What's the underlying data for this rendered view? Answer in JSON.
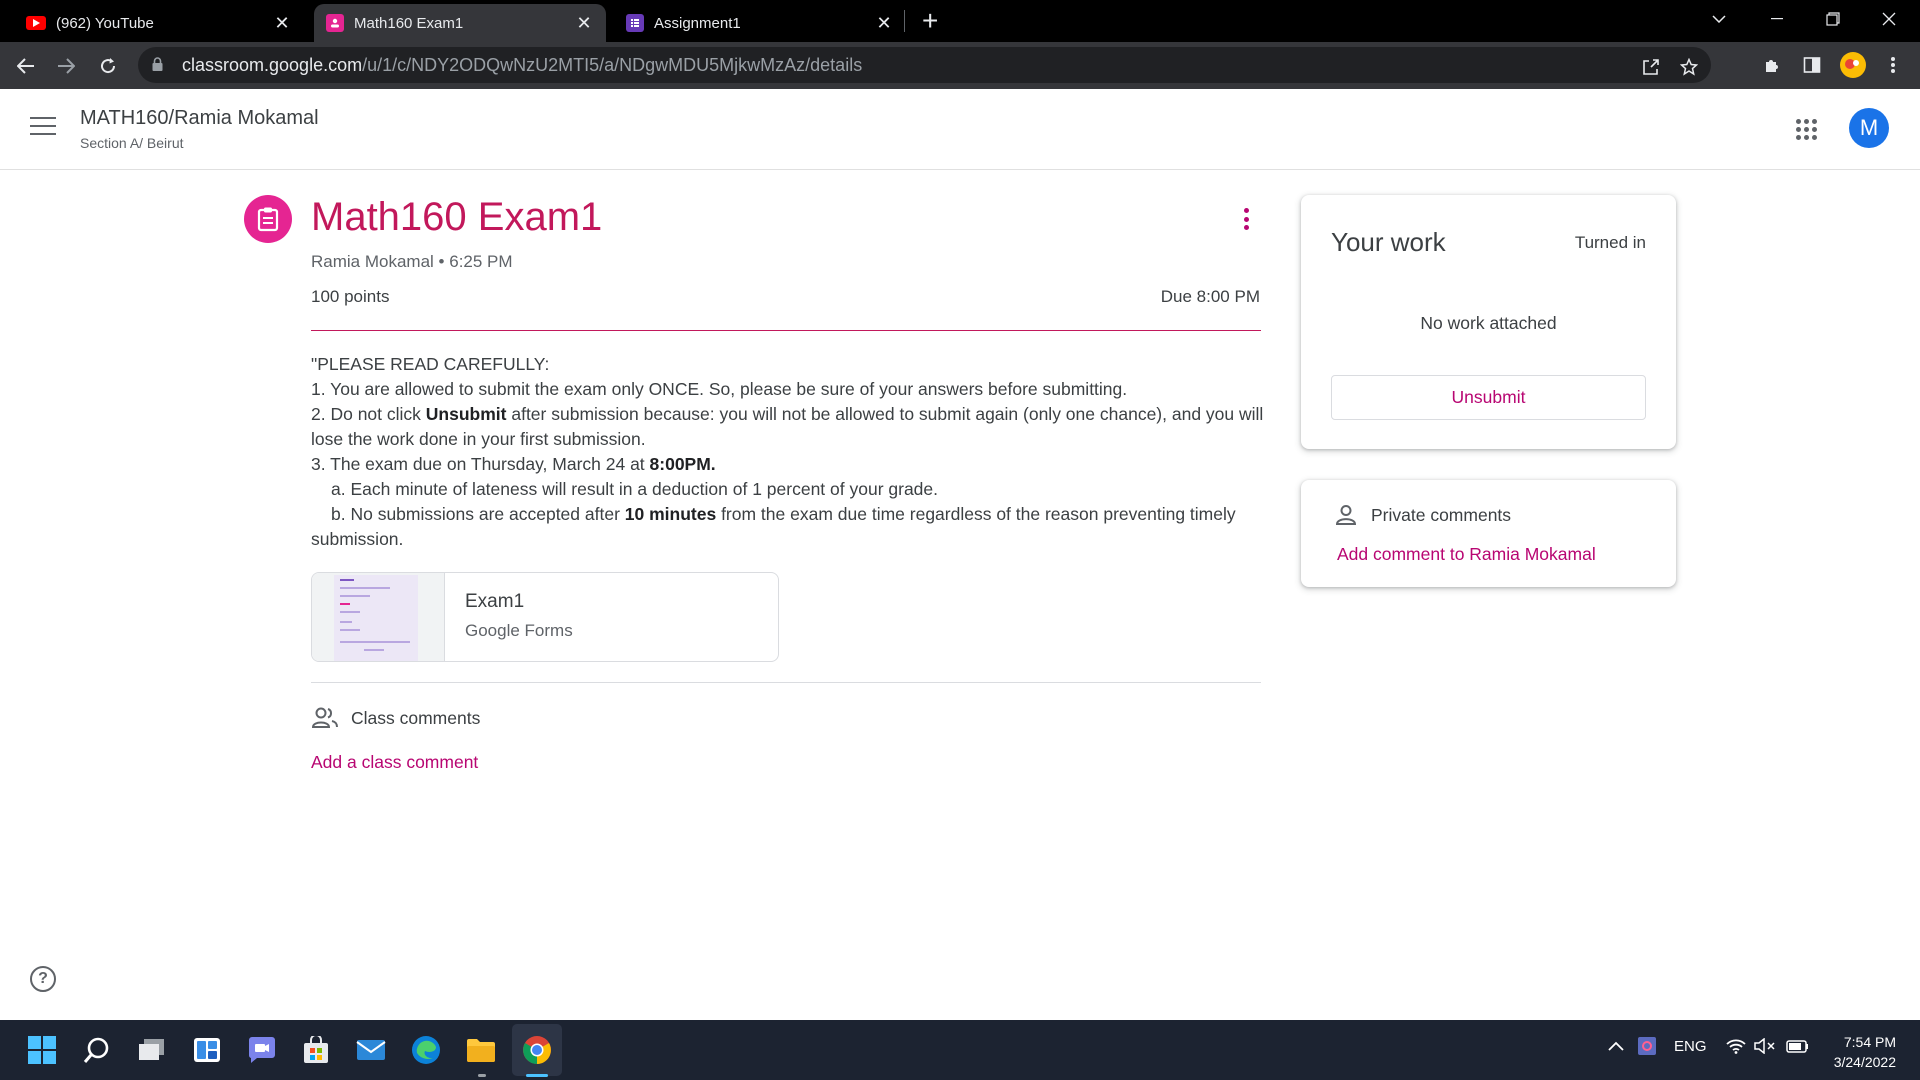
{
  "browser": {
    "tabs": [
      {
        "title": "(962) YouTube",
        "icon": "youtube-icon",
        "active": false
      },
      {
        "title": "Math160 Exam1",
        "icon": "classroom-icon",
        "active": true
      },
      {
        "title": "Assignment1",
        "icon": "forms-icon",
        "active": false
      }
    ],
    "url_host": "classroom.google.com",
    "url_path": "/u/1/c/NDY2ODQwNzU2MTI5/a/NDgwMDU5MjkwMzAz/details"
  },
  "header": {
    "course_title": "MATH160/Ramia Mokamal",
    "course_section": "Section A/ Beirut",
    "avatar_letter": "M"
  },
  "assignment": {
    "title": "Math160 Exam1",
    "author": "Ramia Mokamal",
    "separator": "•",
    "time": "6:25 PM",
    "points": "100 points",
    "due": "Due 8:00 PM",
    "instructions": {
      "l0": "\"PLEASE READ CAREFULLY:",
      "l1": "1. You are allowed to submit the exam only ONCE. So, please be sure of your answers before submitting.",
      "l2a": "2. Do not click ",
      "l2b": "Unsubmit",
      "l2c": " after submission because: you will not be allowed to submit again (only one chance), and you will lose the work done in your first submission.",
      "l3a": "3. The exam due on Thursday, March 24 at ",
      "l3b": "8:00PM.",
      "l4": "a. Each minute of lateness will result in a deduction of 1 percent of your grade.",
      "l5a": "b. No submissions are accepted after ",
      "l5b": "10 minutes",
      "l5c": " from the exam due time regardless of the reason preventing timely submission."
    },
    "attachment": {
      "name": "Exam1",
      "type": "Google Forms"
    },
    "class_comments_label": "Class comments",
    "add_class_comment": "Add a class comment"
  },
  "your_work": {
    "title": "Your work",
    "status": "Turned in",
    "empty_text": "No work attached",
    "unsubmit_label": "Unsubmit"
  },
  "private_comments": {
    "label": "Private comments",
    "add_label": "Add comment to Ramia Mokamal"
  },
  "taskbar": {
    "lang": "ENG",
    "time": "7:54 PM",
    "date": "3/24/2022"
  },
  "colors": {
    "accent": "#c2185b",
    "link": "#b80672",
    "icon_bg": "#e52592",
    "avatar": "#1a73e8"
  }
}
